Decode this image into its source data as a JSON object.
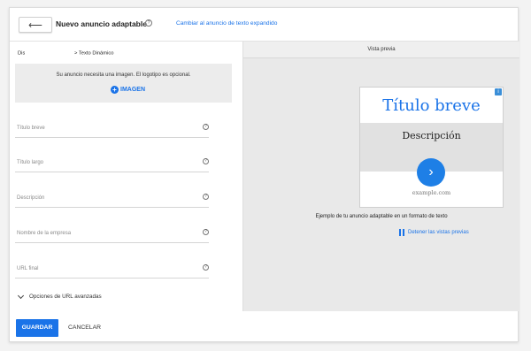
{
  "header": {
    "back_icon": "arrow-left-icon",
    "title": "Nuevo anuncio adaptable",
    "switch_link": "Cambiar al anuncio de texto expandido"
  },
  "breadcrumb": {
    "start": "Dis",
    "end": "> Texto Dinámico"
  },
  "image_section": {
    "message": "Su anuncio necesita una imagen. El logotipo es opcional.",
    "button_label": "IMAGEN"
  },
  "form": {
    "fields": [
      "Título breve",
      "Título largo",
      "Descripción",
      "Nombre de la empresa",
      "URL final"
    ],
    "advanced_label": "Opciones de URL avanzadas"
  },
  "preview": {
    "header": "Vista previa",
    "ad_title": "Título breve",
    "ad_description": "Descripción",
    "ad_url": "example.com",
    "caption": "Ejemplo de tu anuncio adaptable en un formato de texto",
    "stop_label": "Detener las vistas previas"
  },
  "footer": {
    "save_label": "GUARDAR",
    "cancel_label": "CANCELAR"
  },
  "colors": {
    "accent": "#1a73e8",
    "preview_bg": "#e9e9e9"
  }
}
